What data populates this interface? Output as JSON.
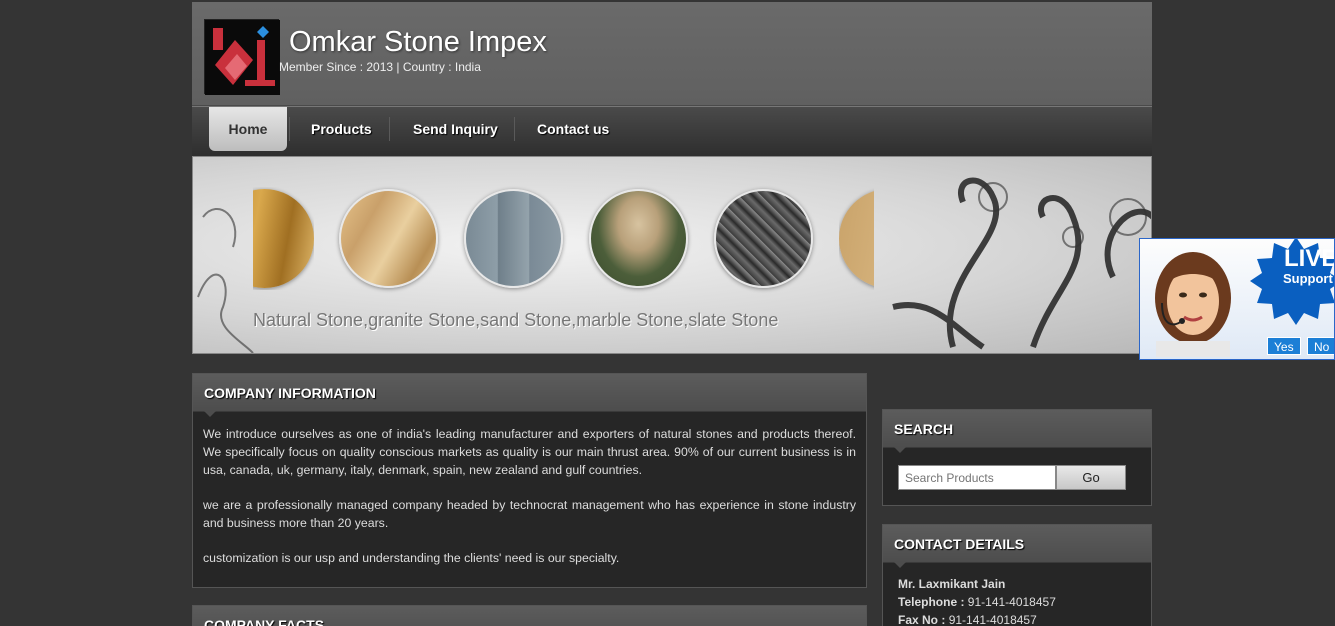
{
  "header": {
    "company_name": "Omkar Stone Impex",
    "member_line": "Member Since : 2013 | Country : India"
  },
  "nav": {
    "items": [
      {
        "label": "Home",
        "active": true
      },
      {
        "label": "Products",
        "active": false
      },
      {
        "label": "Send Inquiry",
        "active": false
      },
      {
        "label": "Contact us",
        "active": false
      }
    ]
  },
  "banner": {
    "caption": "Natural Stone,granite Stone,sand Stone,marble Stone,slate Stone"
  },
  "live_support": {
    "title": "LIVE",
    "subtitle": "Support",
    "yes_label": "Yes",
    "no_label": "No"
  },
  "company_info": {
    "heading": "COMPANY INFORMATION",
    "paragraphs": [
      "We introduce ourselves as one of india's leading manufacturer and exporters of natural stones and products thereof. We specifically focus on quality conscious markets as quality is our main thrust area. 90% of our current business is in usa, canada, uk, germany, italy, denmark, spain, new zealand and gulf countries.",
      "we are a professionally managed company headed by technocrat management who has experience in stone industry and business more than 20 years.",
      "customization is our usp and understanding the clients' need is our specialty."
    ]
  },
  "company_facts": {
    "heading": "COMPANY FACTS"
  },
  "search": {
    "heading": "SEARCH",
    "placeholder": "Search Products",
    "button_label": "Go"
  },
  "contact": {
    "heading": "CONTACT DETAILS",
    "name": "Mr. Laxmikant Jain",
    "phone_label": "Telephone :",
    "phone": "91-141-4018457",
    "fax_label": "Fax No :",
    "fax": "91-141-4018457"
  },
  "colors": {
    "page_bg": "#343434",
    "header_bg": "#666666",
    "accent_blue": "#1c7fd6"
  }
}
